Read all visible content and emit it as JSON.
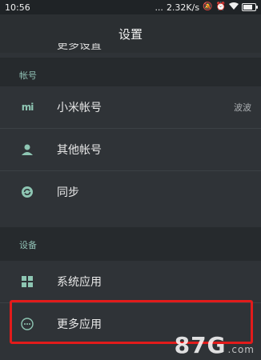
{
  "status_bar": {
    "time": "10:56",
    "dots": "...",
    "network_speed": "2.32K/s",
    "icons": [
      "mute-icon",
      "alarm-icon",
      "wifi-icon",
      "battery-icon"
    ]
  },
  "header": {
    "title": "设置"
  },
  "previous_item": {
    "label": "更多设置"
  },
  "sections": [
    {
      "title": "帐号",
      "items": [
        {
          "label": "小米帐号",
          "value": "波波",
          "icon": "mi-icon"
        },
        {
          "label": "其他帐号",
          "icon": "person-icon"
        },
        {
          "label": "同步",
          "icon": "sync-icon"
        }
      ]
    },
    {
      "title": "设备",
      "items": [
        {
          "label": "系统应用",
          "icon": "grid-icon"
        },
        {
          "label": "更多应用",
          "icon": "more-icon"
        }
      ]
    }
  ],
  "watermark": {
    "text": "87G",
    "sub": ".com"
  },
  "colors": {
    "accent": "#8ec6b3",
    "highlight": "#e21b1b",
    "background": "#2f3337"
  }
}
